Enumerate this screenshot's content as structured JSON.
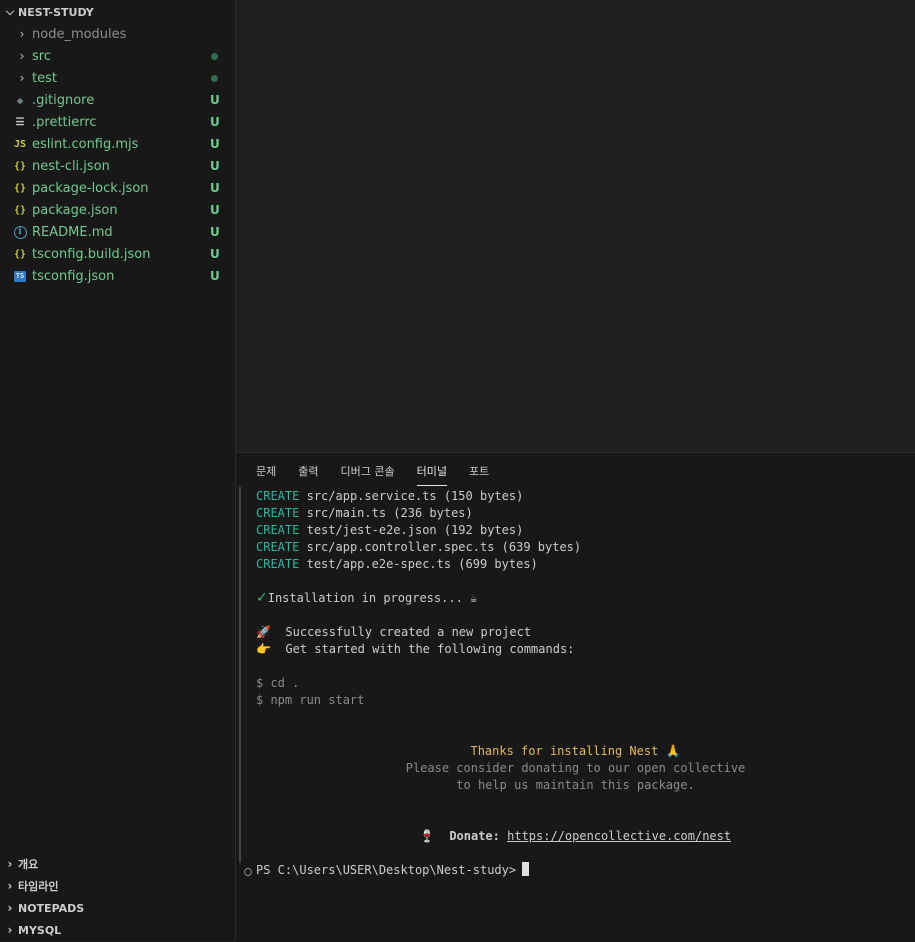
{
  "explorer": {
    "root_label": "NEST-STUDY",
    "items": [
      {
        "name": "node_modules",
        "type": "folder",
        "status": "ignored",
        "icon": "chevron-right-icon",
        "marker": "none"
      },
      {
        "name": "src",
        "type": "folder",
        "status": "untracked",
        "icon": "chevron-right-icon",
        "marker": "dot"
      },
      {
        "name": "test",
        "type": "folder",
        "status": "untracked",
        "icon": "chevron-right-icon",
        "marker": "dot"
      },
      {
        "name": ".gitignore",
        "type": "file",
        "status": "untracked",
        "icon": "git-icon",
        "badge": "U"
      },
      {
        "name": ".prettierrc",
        "type": "file",
        "status": "untracked",
        "icon": "lines-icon",
        "badge": "U"
      },
      {
        "name": "eslint.config.mjs",
        "type": "file",
        "status": "untracked",
        "icon": "js-icon",
        "icon_text": "JS",
        "badge": "U"
      },
      {
        "name": "nest-cli.json",
        "type": "file",
        "status": "untracked",
        "icon": "json-icon",
        "icon_text": "{}",
        "badge": "U"
      },
      {
        "name": "package-lock.json",
        "type": "file",
        "status": "untracked",
        "icon": "json-icon",
        "icon_text": "{}",
        "badge": "U"
      },
      {
        "name": "package.json",
        "type": "file",
        "status": "untracked",
        "icon": "json-icon",
        "icon_text": "{}",
        "badge": "U"
      },
      {
        "name": "README.md",
        "type": "file",
        "status": "untracked",
        "icon": "info-icon",
        "icon_text": "i",
        "badge": "U"
      },
      {
        "name": "tsconfig.build.json",
        "type": "file",
        "status": "untracked",
        "icon": "json-icon",
        "icon_text": "{}",
        "badge": "U"
      },
      {
        "name": "tsconfig.json",
        "type": "file",
        "status": "untracked",
        "icon": "ts-icon",
        "icon_text": "TS",
        "badge": "U"
      }
    ],
    "bottom_sections": [
      "개요",
      "타임라인",
      "NOTEPADS",
      "MYSQL"
    ]
  },
  "panel": {
    "tabs": [
      "문제",
      "출력",
      "디버그 콘솔",
      "터미널",
      "포트"
    ],
    "active_tab": "터미널"
  },
  "terminal": {
    "create_word": "CREATE",
    "create_lines": [
      "src/app.service.ts (150 bytes)",
      "src/main.ts (236 bytes)",
      "test/jest-e2e.json (192 bytes)",
      "src/app.controller.spec.ts (639 bytes)",
      "test/app.e2e-spec.ts (699 bytes)"
    ],
    "check_mark": "✓",
    "install_text": "Installation in progress... ☕",
    "rocket": "🚀",
    "success_text": "Successfully created a new project",
    "pointer": "👉",
    "get_started_text": "Get started with the following commands:",
    "commands": [
      "$ cd .",
      "$ npm run start"
    ],
    "thanks_text": "Thanks for installing Nest 🙏",
    "donate_line1": "Please consider donating to our open collective",
    "donate_line2": "to help us maintain this package.",
    "wine": "🍷",
    "donate_label": "Donate:",
    "donate_url": "https://opencollective.com/nest",
    "prompt": "PS C:\\Users\\USER\\Desktop\\Nest-study>"
  },
  "colors": {
    "untracked": "#73c991",
    "ignored": "#8c8c8c",
    "create_green": "#2eb5a0",
    "thanks_yellow": "#e5b95c"
  }
}
